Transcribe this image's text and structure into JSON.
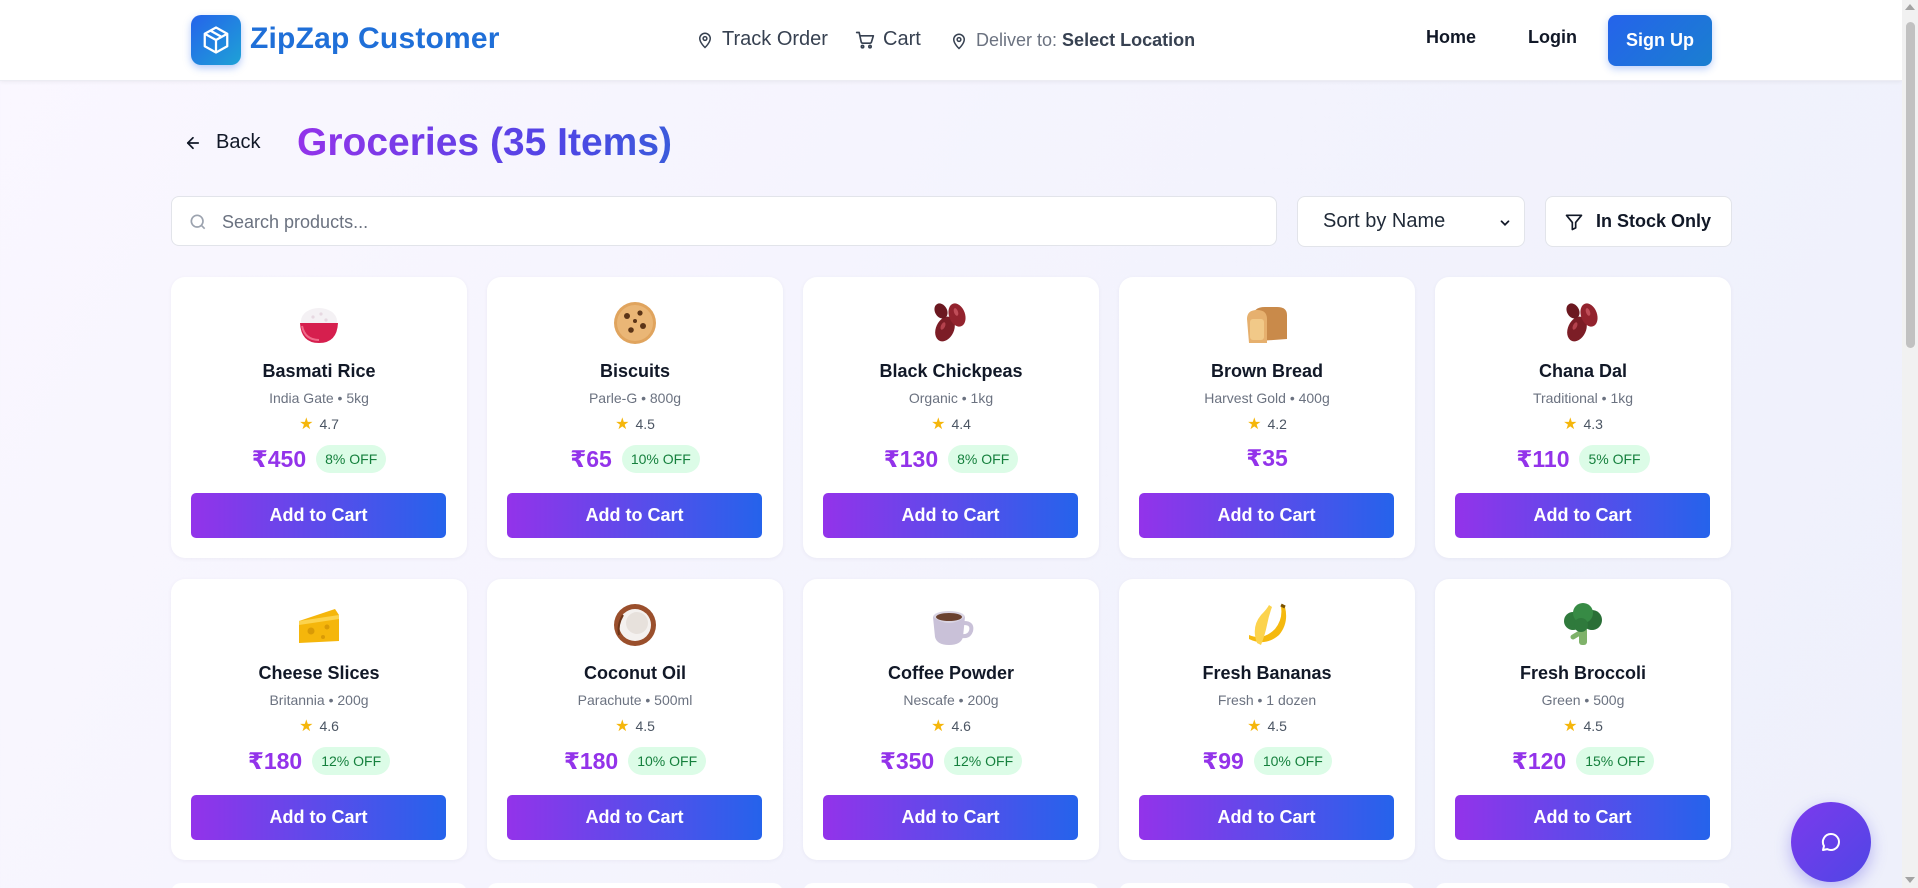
{
  "header": {
    "brand": "ZipZap Customer",
    "logo_icon": "package-cube-icon",
    "track_order": "Track Order",
    "cart": "Cart",
    "deliver_label": "Deliver to:",
    "deliver_value": "Select Location",
    "home": "Home",
    "login": "Login",
    "signup": "Sign Up"
  },
  "page": {
    "back": "Back",
    "title": "Groceries (35 Items)"
  },
  "filters": {
    "search_placeholder": "Search products...",
    "sort_value": "Sort by Name",
    "in_stock": "In Stock Only"
  },
  "products": [
    {
      "name": "Basmati Rice",
      "sub": "India Gate • 5kg",
      "rating": "4.7",
      "price": "₹450",
      "off": "8% OFF",
      "icon": "rice-bowl-icon",
      "button": "Add to Cart"
    },
    {
      "name": "Biscuits",
      "sub": "Parle-G • 800g",
      "rating": "4.5",
      "price": "₹65",
      "off": "10% OFF",
      "icon": "cookie-icon",
      "button": "Add to Cart"
    },
    {
      "name": "Black Chickpeas",
      "sub": "Organic • 1kg",
      "rating": "4.4",
      "price": "₹130",
      "off": "8% OFF",
      "icon": "beans-icon",
      "button": "Add to Cart"
    },
    {
      "name": "Brown Bread",
      "sub": "Harvest Gold • 400g",
      "rating": "4.2",
      "price": "₹35",
      "off": "",
      "icon": "bread-icon",
      "button": "Add to Cart"
    },
    {
      "name": "Chana Dal",
      "sub": "Traditional • 1kg",
      "rating": "4.3",
      "price": "₹110",
      "off": "5% OFF",
      "icon": "beans-icon",
      "button": "Add to Cart"
    },
    {
      "name": "Cheese Slices",
      "sub": "Britannia • 200g",
      "rating": "4.6",
      "price": "₹180",
      "off": "12% OFF",
      "icon": "cheese-icon",
      "button": "Add to Cart"
    },
    {
      "name": "Coconut Oil",
      "sub": "Parachute • 500ml",
      "rating": "4.5",
      "price": "₹180",
      "off": "10% OFF",
      "icon": "coconut-icon",
      "button": "Add to Cart"
    },
    {
      "name": "Coffee Powder",
      "sub": "Nescafe • 200g",
      "rating": "4.6",
      "price": "₹350",
      "off": "12% OFF",
      "icon": "coffee-cup-icon",
      "button": "Add to Cart"
    },
    {
      "name": "Fresh Bananas",
      "sub": "Fresh • 1 dozen",
      "rating": "4.5",
      "price": "₹99",
      "off": "10% OFF",
      "icon": "banana-icon",
      "button": "Add to Cart"
    },
    {
      "name": "Fresh Broccoli",
      "sub": "Green • 500g",
      "rating": "4.5",
      "price": "₹120",
      "off": "15% OFF",
      "icon": "broccoli-icon",
      "button": "Add to Cart"
    }
  ],
  "colors": {
    "brand_blue": "#1f6fd8",
    "price_purple": "#9333ea",
    "discount_green": "#15803d",
    "discount_bg": "#dcfce7",
    "button_gradient_start": "#9333ea",
    "button_gradient_end": "#2563eb"
  },
  "chat": {
    "icon": "chat-bubble-icon"
  }
}
